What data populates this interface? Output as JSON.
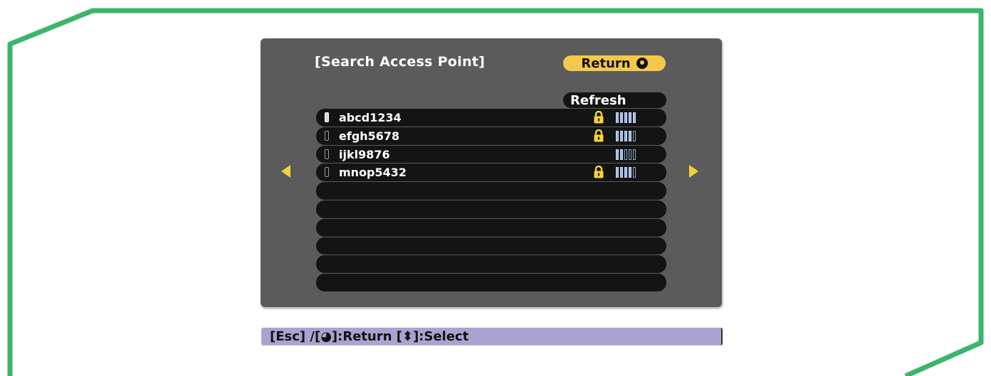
{
  "screen": {
    "title": "[Search Access Point]",
    "return_label": "Return",
    "refresh_label": "Refresh"
  },
  "access_points": [
    {
      "ssid": "abcd1234",
      "selected": true,
      "locked": true,
      "signal_bars": 5
    },
    {
      "ssid": "efgh5678",
      "selected": false,
      "locked": true,
      "signal_bars": 4
    },
    {
      "ssid": "ijkl9876",
      "selected": false,
      "locked": false,
      "signal_bars": 2
    },
    {
      "ssid": "mnop5432",
      "selected": false,
      "locked": true,
      "signal_bars": 4
    }
  ],
  "empty_rows": 6,
  "help_bar": "[Esc] /[◕]:Return  [⬍]:Select",
  "colors": {
    "panel": "#5b5b5b",
    "row": "#141414",
    "accent": "#f4c94b",
    "nav_arrow": "#f4d13a",
    "help_bar": "#a9a4cf",
    "signal": "#9fb7e6",
    "frame": "#3cb56a"
  },
  "icons": {
    "return": "return-icon",
    "lock": "lock-icon",
    "signal": "signal-strength-icon",
    "prev": "left-arrow-icon",
    "next": "right-arrow-icon"
  }
}
